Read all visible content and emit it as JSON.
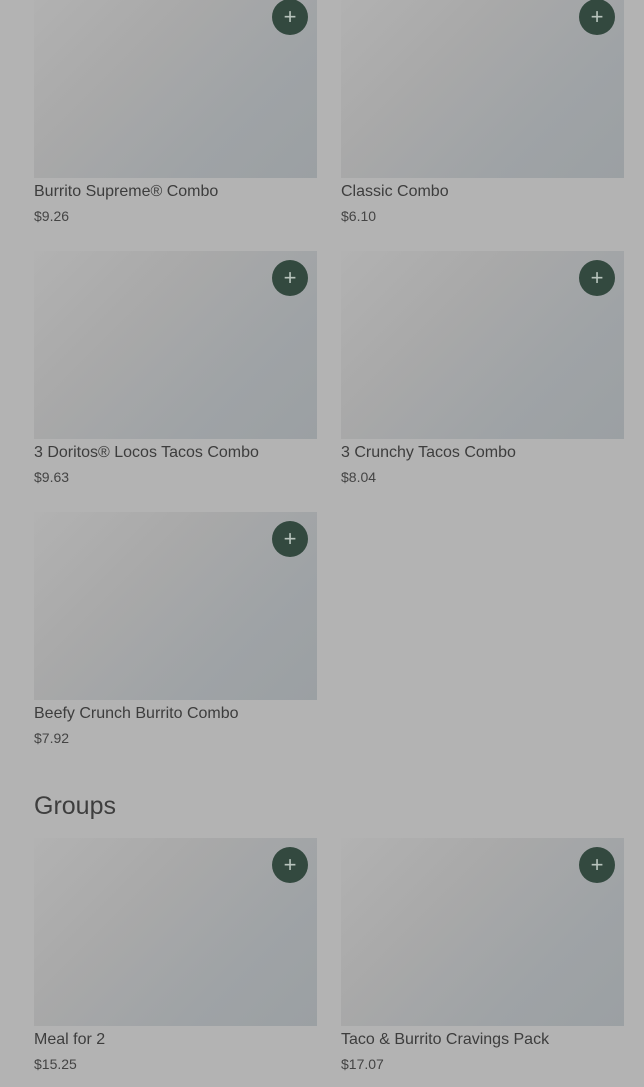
{
  "combos": [
    {
      "name": "Burrito Supreme® Combo",
      "price": "$9.26"
    },
    {
      "name": "Classic Combo",
      "price": "$6.10"
    },
    {
      "name": "3 Doritos® Locos Tacos Combo",
      "price": "$9.63"
    },
    {
      "name": "3 Crunchy Tacos Combo",
      "price": "$8.04"
    },
    {
      "name": "Beefy Crunch Burrito Combo",
      "price": "$7.92"
    }
  ],
  "groups": {
    "title": "Groups",
    "items": [
      {
        "name": "Meal for 2",
        "price": "$15.25"
      },
      {
        "name": "Taco & Burrito Cravings Pack",
        "price": "$17.07"
      }
    ]
  },
  "icons": {
    "add": "plus-icon"
  },
  "colors": {
    "add_button": "#33493f",
    "overlay": "#b3b3b3"
  }
}
